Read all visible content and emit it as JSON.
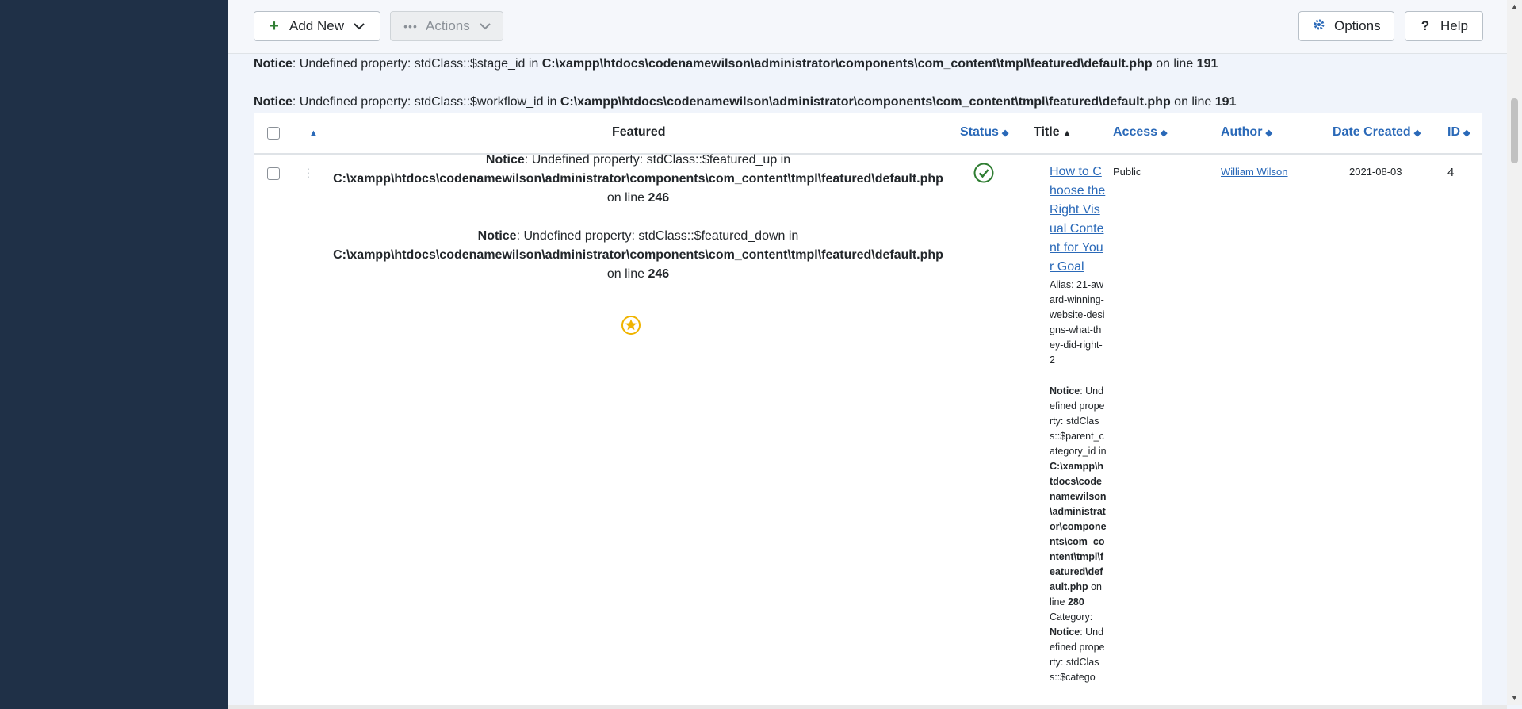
{
  "toolbar": {
    "add_new": "Add New",
    "actions": "Actions",
    "options": "Options",
    "help": "Help"
  },
  "notices_top": [
    {
      "label": "Notice",
      "text": ": Undefined property: stdClass::$stage_id in ",
      "path": "C:\\xampp\\htdocs\\codenamewilson\\administrator\\components\\com_content\\tmpl\\featured\\default.php",
      "online": " on line ",
      "line": "191"
    },
    {
      "label": "Notice",
      "text": ": Undefined property: stdClass::$workflow_id in ",
      "path": "C:\\xampp\\htdocs\\codenamewilson\\administrator\\components\\com_content\\tmpl\\featured\\default.php",
      "online": " on line ",
      "line": "191"
    }
  ],
  "table": {
    "headers": {
      "featured": "Featured",
      "status": "Status",
      "title": "Title",
      "access": "Access",
      "author": "Author",
      "date_created": "Date Created",
      "id": "ID"
    },
    "row": {
      "featured_notices": [
        {
          "label": "Notice",
          "text": ": Undefined property: stdClass::$featured_up in",
          "path": "C:\\xampp\\htdocs\\codenamewilson\\administrator\\components\\com_content\\tmpl\\featured\\default.php",
          "online": "on line ",
          "line": "246"
        },
        {
          "label": "Notice",
          "text": ": Undefined property: stdClass::$featured_down in",
          "path": "C:\\xampp\\htdocs\\codenamewilson\\administrator\\components\\com_content\\tmpl\\featured\\default.php",
          "online": "on line ",
          "line": "246"
        }
      ],
      "title": "How to Choose the Right Visual Content for Your Goal",
      "alias": "Alias: 21-award-winning-website-designs-what-they-did-right-2",
      "notice_parent": {
        "label": "Notice",
        "text": ": Undefined property: stdClass::$parent_category_id in ",
        "path": "C:\\xampp\\htdocs\\codenamewilson\\administrator\\components\\com_content\\tmpl\\featured\\default.php",
        "online": " on line ",
        "line": "280"
      },
      "category_label": "Category:",
      "notice_category": {
        "label": "Notice",
        "text": ": Undefined property: stdClass::$catego"
      },
      "access": "Public",
      "author": "William Wilson",
      "date_created": "2021-08-03",
      "id": "4"
    }
  },
  "colors": {
    "sidebar": "#1f3047",
    "link": "#2a69b8",
    "success": "#2f7d32",
    "featured": "#f0b400"
  }
}
